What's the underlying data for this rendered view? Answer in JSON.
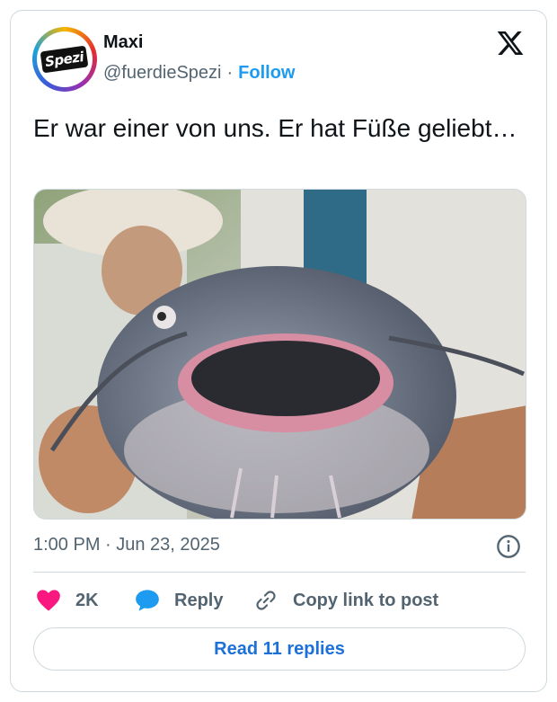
{
  "author": {
    "name": "Maxi",
    "handle": "@fuerdieSpezi",
    "separator": "·",
    "follow_label": "Follow",
    "avatar_text": "Spezi"
  },
  "tweet": {
    "text": "Er war einer von uns. Er hat Füße geliebt…",
    "timestamp": "1:00 PM · Jun 23, 2025",
    "media_description_icon": "catfish-photo"
  },
  "actions": {
    "like_count": "2K",
    "reply_label": "Reply",
    "copy_label": "Copy link to post",
    "read_replies_label": "Read 11 replies"
  },
  "colors": {
    "like": "#f91880",
    "reply": "#1d9bf0",
    "follow": "#1d9bf0",
    "read_replies": "#1d70d8"
  },
  "icons": {
    "brand": "x-logo-icon",
    "info": "info-icon",
    "like": "heart-icon",
    "reply": "speech-bubble-icon",
    "copy": "link-icon"
  }
}
